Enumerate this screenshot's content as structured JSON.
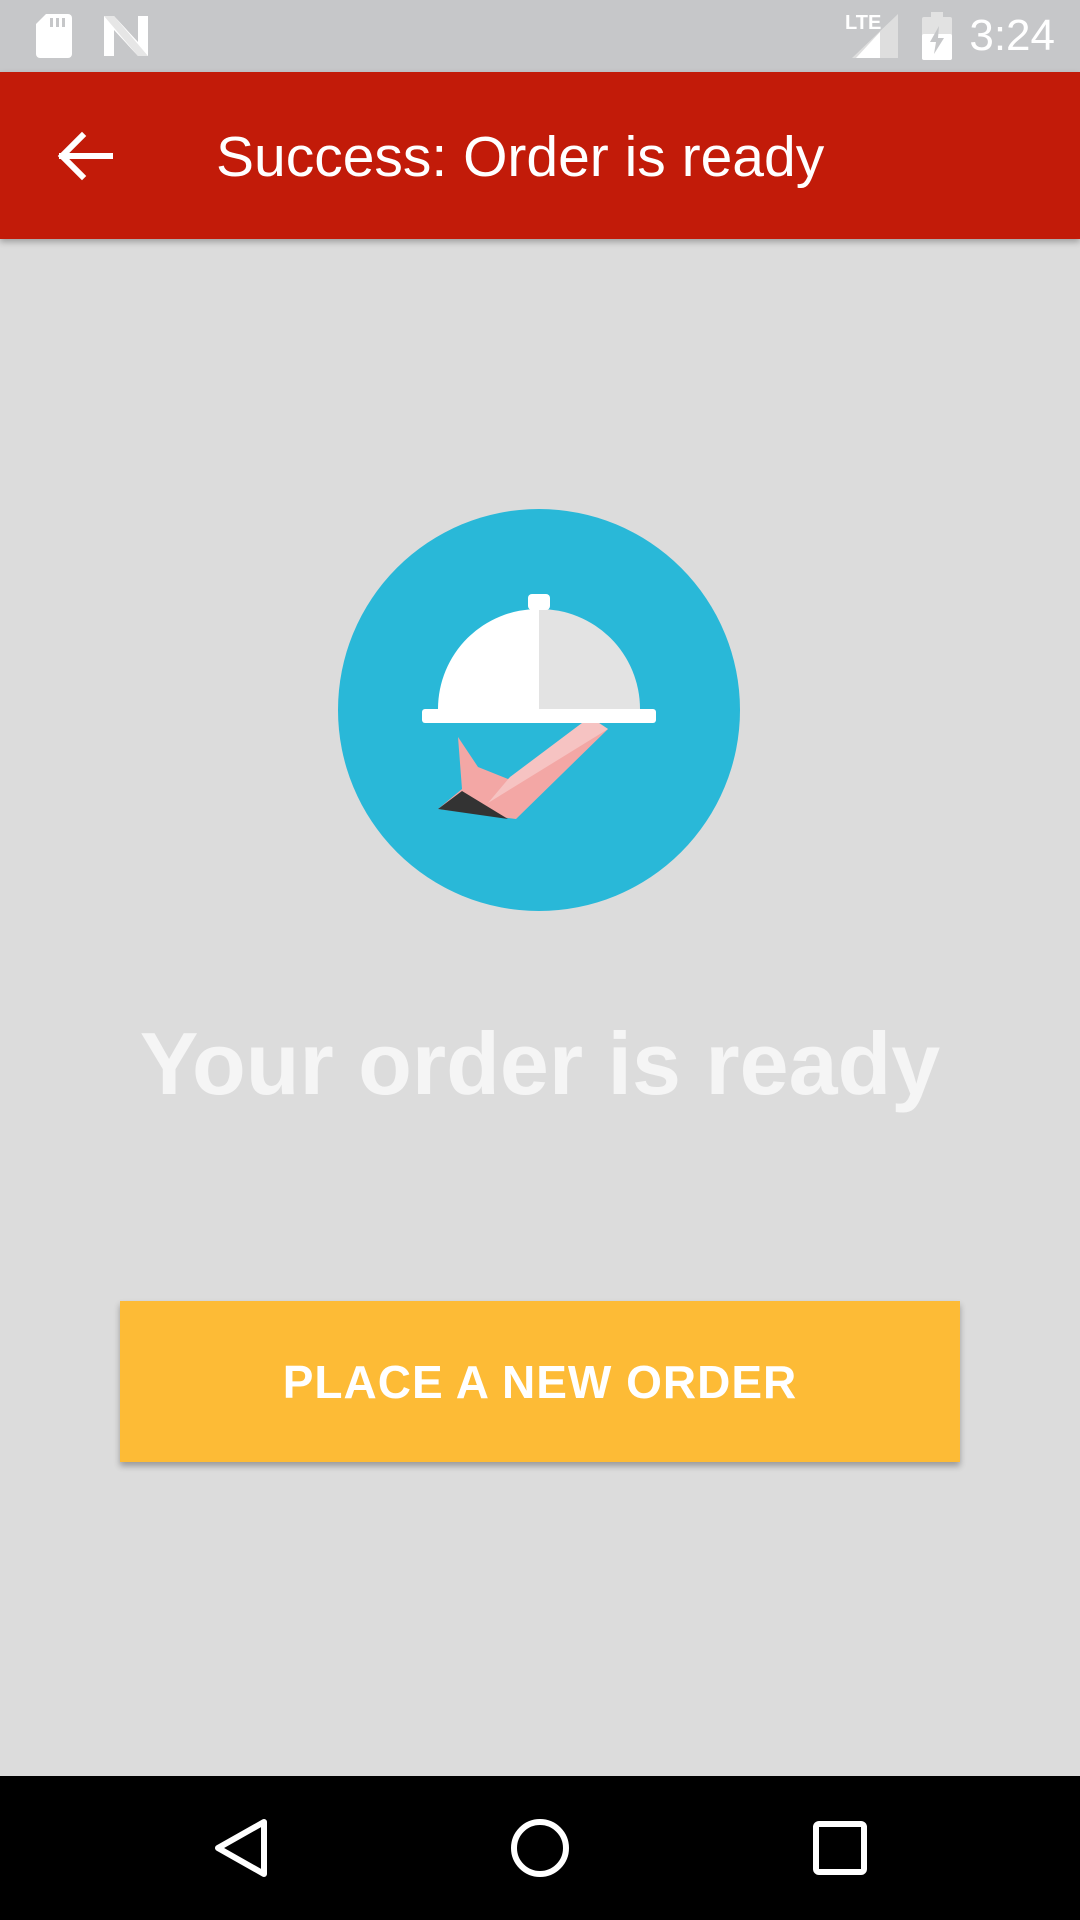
{
  "status_bar": {
    "time": "3:24",
    "network": "LTE",
    "icons": [
      "sd-card-icon",
      "n-logo-icon",
      "lte-signal-icon",
      "battery-charging-icon"
    ]
  },
  "app_bar": {
    "title": "Success: Order is ready",
    "background_color": "#c21b09",
    "back_icon": "arrow-left-icon"
  },
  "main": {
    "illustration_icon": "serving-cloche-hand-icon",
    "illustration_color": "#29b8d8",
    "headline": "Your order is ready",
    "button_label": "PLACE A NEW ORDER",
    "button_color": "#fdbb36"
  },
  "nav_bar": {
    "icons": [
      "nav-back-icon",
      "nav-home-icon",
      "nav-recents-icon"
    ]
  }
}
